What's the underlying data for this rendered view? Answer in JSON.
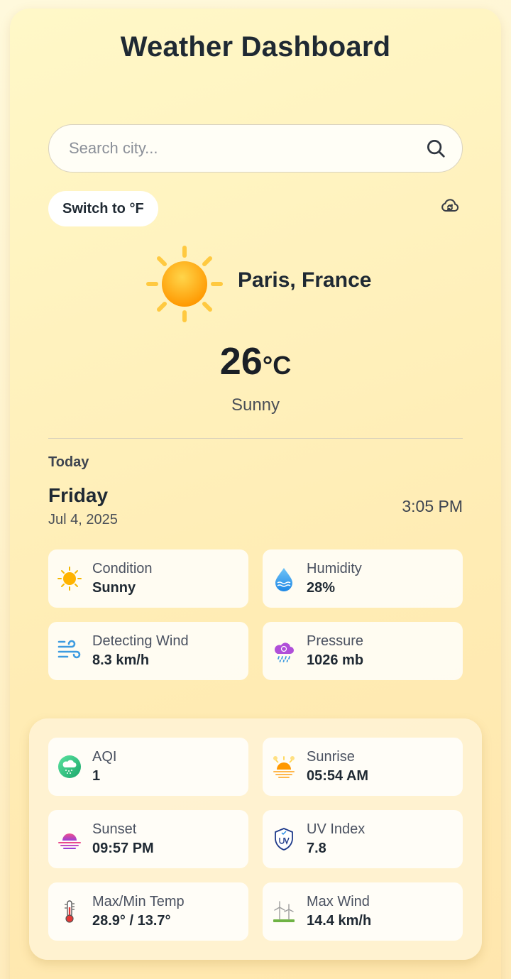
{
  "app": {
    "title": "Weather Dashboard",
    "accent_color": "#f9a825",
    "background_color": "#fff3c8"
  },
  "search": {
    "placeholder": "Search city...",
    "value": "",
    "icon": "search-icon"
  },
  "controls": {
    "unit_toggle_label": "Switch to °F",
    "sync_icon": "cloud-sync-icon"
  },
  "current": {
    "city": "Paris, France",
    "temperature": "26",
    "unit": "°C",
    "condition": "Sunny",
    "icon": "sun-icon"
  },
  "today": {
    "label": "Today",
    "day": "Friday",
    "date": "Jul 4, 2025",
    "time": "3:05 PM"
  },
  "stats": [
    {
      "label": "Condition",
      "value": "Sunny",
      "icon": "sun-icon"
    },
    {
      "label": "Humidity",
      "value": "28%",
      "icon": "water-drop-icon"
    },
    {
      "label": "Detecting Wind",
      "value": "8.3 km/h",
      "icon": "wind-icon"
    },
    {
      "label": "Pressure",
      "value": "1026 mb",
      "icon": "pressure-cloud-icon"
    }
  ],
  "details": [
    {
      "label": "AQI",
      "value": "1",
      "icon": "aqi-icon"
    },
    {
      "label": "Sunrise",
      "value": "05:54 AM",
      "icon": "sunrise-icon"
    },
    {
      "label": "Sunset",
      "value": "09:57 PM",
      "icon": "sunset-icon"
    },
    {
      "label": "UV Index",
      "value": "7.8",
      "icon": "uv-shield-icon"
    },
    {
      "label": "Max/Min Temp",
      "value": "28.9° / 13.7°",
      "icon": "thermometer-icon"
    },
    {
      "label": "Max Wind",
      "value": "14.4 km/h",
      "icon": "wind-turbine-icon"
    }
  ]
}
